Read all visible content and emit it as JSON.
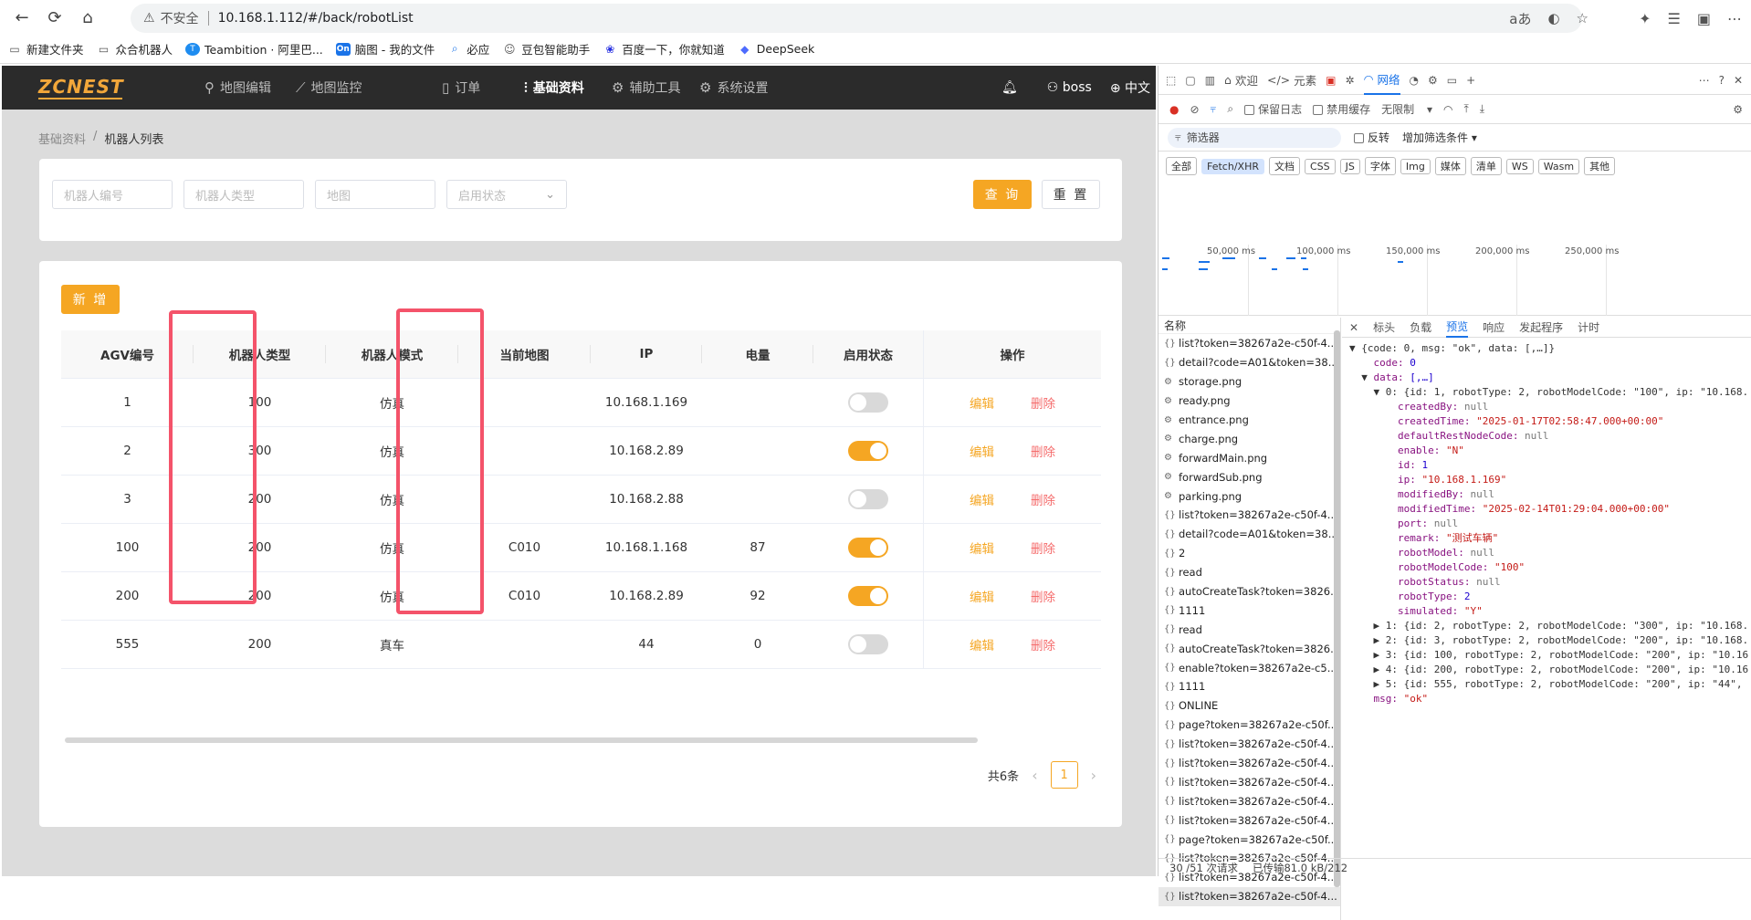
{
  "browser": {
    "insecure_label": "不安全",
    "url": "10.168.1.112/#/back/robotList",
    "bookmarks": [
      {
        "label": "新建文件夹"
      },
      {
        "label": "众合机器人"
      },
      {
        "label": "Teambition · 阿里巴..."
      },
      {
        "label": "脑图 - 我的文件"
      },
      {
        "label": "必应"
      },
      {
        "label": "豆包智能助手"
      },
      {
        "label": "百度一下，你就知道"
      },
      {
        "label": "DeepSeek"
      }
    ]
  },
  "app": {
    "logo": "ZCNEST",
    "menu": [
      {
        "label": "地图编辑"
      },
      {
        "label": "地图监控"
      },
      {
        "label": "订单"
      },
      {
        "label": "基础资料"
      },
      {
        "label": "辅助工具"
      },
      {
        "label": "系统设置"
      }
    ],
    "user": "boss",
    "language": "中文",
    "breadcrumb": {
      "parent": "基础资料",
      "separator": "/",
      "current": "机器人列表"
    },
    "filters": {
      "robot_code_placeholder": "机器人编号",
      "robot_type_placeholder": "机器人类型",
      "map_placeholder": "地图",
      "status_placeholder": "启用状态",
      "query_label": "查 询",
      "reset_label": "重 置"
    },
    "add_label": "新 增",
    "table": {
      "columns": [
        "AGV编号",
        "机器人类型",
        "机器人模式",
        "当前地图",
        "IP",
        "电量",
        "启用状态",
        "操作"
      ],
      "edit_label": "编辑",
      "delete_label": "删除",
      "rows": [
        {
          "agv": "1",
          "type": "100",
          "mode": "仿真",
          "map": "",
          "ip": "10.168.1.169",
          "battery": "",
          "enabled": false
        },
        {
          "agv": "2",
          "type": "300",
          "mode": "仿真",
          "map": "",
          "ip": "10.168.2.89",
          "battery": "",
          "enabled": true
        },
        {
          "agv": "3",
          "type": "200",
          "mode": "仿真",
          "map": "",
          "ip": "10.168.2.88",
          "battery": "",
          "enabled": false
        },
        {
          "agv": "100",
          "type": "200",
          "mode": "仿真",
          "map": "C010",
          "ip": "10.168.1.168",
          "battery": "87",
          "enabled": true
        },
        {
          "agv": "200",
          "type": "200",
          "mode": "仿真",
          "map": "C010",
          "ip": "10.168.2.89",
          "battery": "92",
          "enabled": true
        },
        {
          "agv": "555",
          "type": "200",
          "mode": "真车",
          "map": "",
          "ip": "44",
          "battery": "0",
          "enabled": false
        }
      ]
    },
    "pagination": {
      "total_label": "共6条",
      "current_page": "1"
    }
  },
  "devtools": {
    "tabs": [
      "欢迎",
      "元素",
      "网络"
    ],
    "toolbar": {
      "preserve_log": "保留日志",
      "disable_cache": "禁用缓存",
      "throttle": "无限制"
    },
    "filter": {
      "placeholder": "筛选器",
      "invert": "反转",
      "more": "增加筛选条件"
    },
    "types": [
      "全部",
      "Fetch/XHR",
      "文档",
      "CSS",
      "JS",
      "字体",
      "Img",
      "媒体",
      "清单",
      "WS",
      "Wasm",
      "其他"
    ],
    "timeline_ticks": [
      "50,000 ms",
      "100,000 ms",
      "150,000 ms",
      "200,000 ms",
      "250,000 ms"
    ],
    "name_header": "名称",
    "requests": [
      "list?token=38267a2e-c50f-4...",
      "detail?code=A01&token=38...",
      "storage.png",
      "ready.png",
      "entrance.png",
      "charge.png",
      "forwardMain.png",
      "forwardSub.png",
      "parking.png",
      "list?token=38267a2e-c50f-4...",
      "detail?code=A01&token=38...",
      "2",
      "read",
      "autoCreateTask?token=3826...",
      "1111",
      "read",
      "autoCreateTask?token=3826...",
      "enable?token=38267a2e-c5...",
      "1111",
      "ONLINE",
      "page?token=38267a2e-c50f...",
      "list?token=38267a2e-c50f-4...",
      "list?token=38267a2e-c50f-4...",
      "list?token=38267a2e-c50f-4...",
      "list?token=38267a2e-c50f-4...",
      "list?token=38267a2e-c50f-4...",
      "page?token=38267a2e-c50f...",
      "list?token=38267a2e-c50f-4...",
      "list?token=38267a2e-c50f-4...",
      "list?token=38267a2e-c50f-4..."
    ],
    "panel_tabs": [
      "标头",
      "负载",
      "预览",
      "响应",
      "发起程序",
      "计时"
    ],
    "preview_lines": [
      "▼ {code: 0, msg: \"ok\", data: [,…]}",
      "    code: 0",
      "  ▼ data: [,…]",
      "    ▼ 0: {id: 1, robotType: 2, robotModelCode: \"100\", ip: \"10.168.",
      "        createdBy: null",
      "        createdTime: \"2025-01-17T02:58:47.000+00:00\"",
      "        defaultRestNodeCode: null",
      "        enable: \"N\"",
      "        id: 1",
      "        ip: \"10.168.1.169\"",
      "        modifiedBy: null",
      "        modifiedTime: \"2025-02-14T01:29:04.000+00:00\"",
      "        port: null",
      "        remark: \"测试车辆\"",
      "        robotModel: null",
      "        robotModelCode: \"100\"",
      "        robotStatus: null",
      "        robotType: 2",
      "        simulated: \"Y\"",
      "    ▶ 1: {id: 2, robotType: 2, robotModelCode: \"300\", ip: \"10.168.",
      "    ▶ 2: {id: 3, robotType: 2, robotModelCode: \"200\", ip: \"10.168.",
      "    ▶ 3: {id: 100, robotType: 2, robotModelCode: \"200\", ip: \"10.16",
      "    ▶ 4: {id: 200, robotType: 2, robotModelCode: \"200\", ip: \"10.16",
      "    ▶ 5: {id: 555, robotType: 2, robotModelCode: \"200\", ip: \"44\",",
      "    msg: \"ok\""
    ],
    "status": {
      "requests": "30 /51 次请求",
      "transferred": "已传输81.0 kB/212"
    },
    "colors": {
      "accent": "#1a73e8"
    }
  },
  "colors": {
    "brand": "#f5a623",
    "highlight": "#f4536a",
    "danger": "#f56c6c"
  }
}
